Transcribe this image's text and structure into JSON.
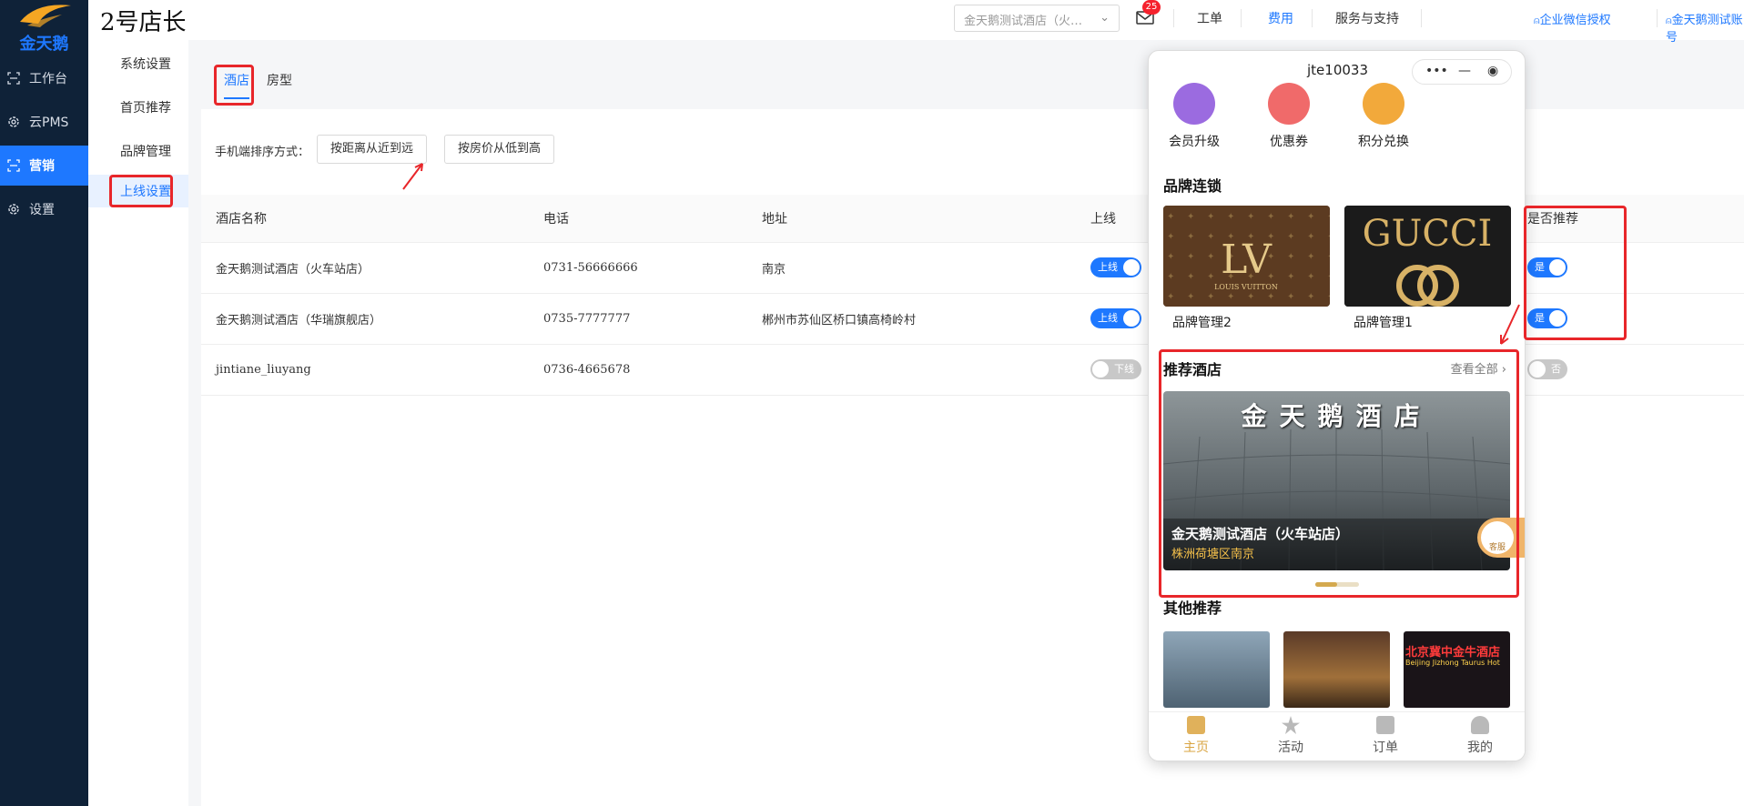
{
  "brand": {
    "logo_text": "金天鹅"
  },
  "header": {
    "store_title": "2号店长",
    "store_select": "金天鹅测试酒店（火…",
    "message_count": "25",
    "links": [
      "工单",
      "费用",
      "服务与支持",
      "企业微信授权",
      "金天鹅测试账号"
    ]
  },
  "nav": {
    "items": [
      {
        "label": "工作台"
      },
      {
        "label": "云PMS"
      },
      {
        "label": "营销"
      },
      {
        "label": "设置"
      }
    ],
    "active_index": 2
  },
  "subnav": {
    "items": [
      "系统设置",
      "首页推荐",
      "品牌管理",
      "上线设置"
    ],
    "active_index": 3
  },
  "main": {
    "tabs": [
      "酒店",
      "房型"
    ],
    "active_tab": 0,
    "sort_label": "手机端排序方式：",
    "sort_buttons": [
      "按距离从近到远",
      "按房价从低到高"
    ],
    "table": {
      "columns": [
        "酒店名称",
        "电话",
        "地址",
        "上线",
        "是否推荐"
      ],
      "rows": [
        {
          "name": "金天鹅测试酒店（火车站店）",
          "phone": "0731-56666666",
          "address": "南京",
          "online": "上线",
          "online_on": true,
          "recommend": "是",
          "recommend_on": true
        },
        {
          "name": "金天鹅测试酒店（华瑞旗舰店）",
          "phone": "0735-7777777",
          "address": "郴州市苏仙区桥口镇高椅岭村",
          "online": "上线",
          "online_on": true,
          "recommend": "是",
          "recommend_on": true
        },
        {
          "name": "jintiane_liuyang",
          "phone": "0736-4665678",
          "address": "",
          "online": "下线",
          "online_on": false,
          "recommend": "否",
          "recommend_on": false
        }
      ]
    }
  },
  "phone": {
    "title": "jte10033",
    "quick_links": [
      "会员升级",
      "优惠券",
      "积分兑换"
    ],
    "brand_section": "品牌连锁",
    "brands": [
      {
        "name": "品牌管理2",
        "logo_text": "LV",
        "logo_subtext": "LOUIS VUITTON"
      },
      {
        "name": "品牌管理1",
        "logo_text": "GUCCI"
      }
    ],
    "recommend_section": "推荐酒店",
    "see_all": "查看全部 ›",
    "banner": {
      "sign": "金天鹅酒店",
      "name": "金天鹅测试酒店（火车站店）",
      "address": "株洲荷塘区南京"
    },
    "kefu": "客服",
    "other_section": "其他推荐",
    "other_sign": "Beijing Jizhong Taurus Hot",
    "tabbar": [
      "主页",
      "活动",
      "订单",
      "我的"
    ],
    "tabbar_active": 0,
    "colors": {
      "accent": "#d9a442",
      "primary": "#1e78ff",
      "annotation": "#e8262a"
    }
  }
}
